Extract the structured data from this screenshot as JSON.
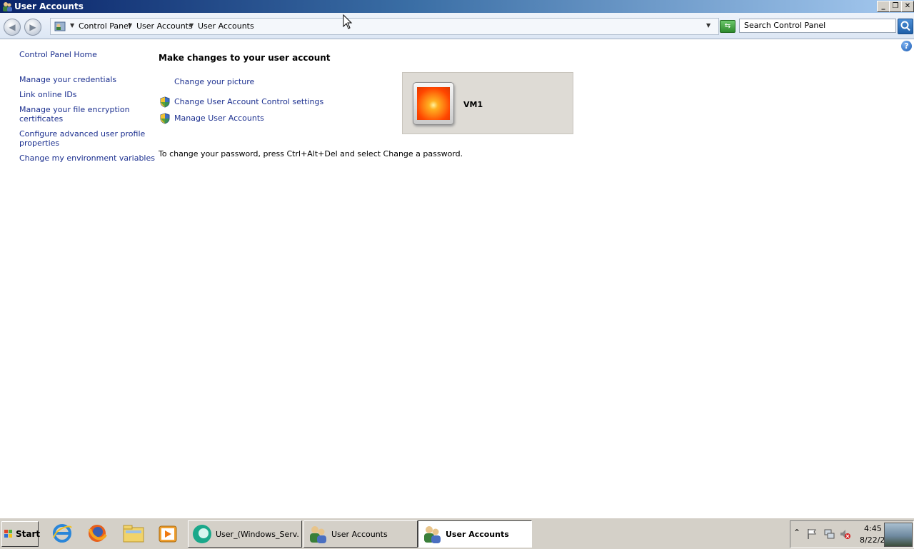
{
  "window": {
    "title": "User Accounts",
    "controls": {
      "minimize": "_",
      "restore": "❐",
      "close": "✕"
    }
  },
  "addressbar": {
    "breadcrumbs": [
      "Control Panel",
      "User Accounts",
      "User Accounts"
    ],
    "search_placeholder": "Search Control Panel"
  },
  "sidebar": {
    "home": "Control Panel Home",
    "links": [
      {
        "label": "Manage your credentials"
      },
      {
        "label": "Link online IDs"
      },
      {
        "label_line1": "Manage your file encryption",
        "label_line2": "certificates"
      },
      {
        "label_line1": "Configure advanced user profile",
        "label_line2": "properties"
      },
      {
        "label": "Change my environment variables"
      }
    ]
  },
  "main": {
    "heading": "Make changes to your user account",
    "tasks": [
      {
        "label": "Change your picture",
        "icon": "none"
      },
      {
        "label": "Change User Account Control settings",
        "icon": "uac-shield-icon"
      },
      {
        "label": "Manage User Accounts",
        "icon": "uac-shield-icon"
      }
    ],
    "password_note": "To change your password, press Ctrl+Alt+Del and select Change a password.",
    "account": {
      "name": "VM1",
      "picture": "orange-flower"
    }
  },
  "taskbar": {
    "start_label": "Start",
    "quick_launch": [
      "internet-explorer-icon",
      "firefox-icon",
      "explorer-folder-icon",
      "media-player-icon"
    ],
    "buttons": [
      {
        "label": "User_(Windows_Serv...",
        "active": false
      },
      {
        "label": "User Accounts",
        "active": false
      },
      {
        "label": "User Accounts",
        "active": true
      }
    ],
    "tray": {
      "time": "4:45 /",
      "date": "8/22/2"
    }
  },
  "colors": {
    "link": "#1b2f8f",
    "titlebar_start": "#0a246a",
    "panel_bg": "#dedbd5"
  }
}
